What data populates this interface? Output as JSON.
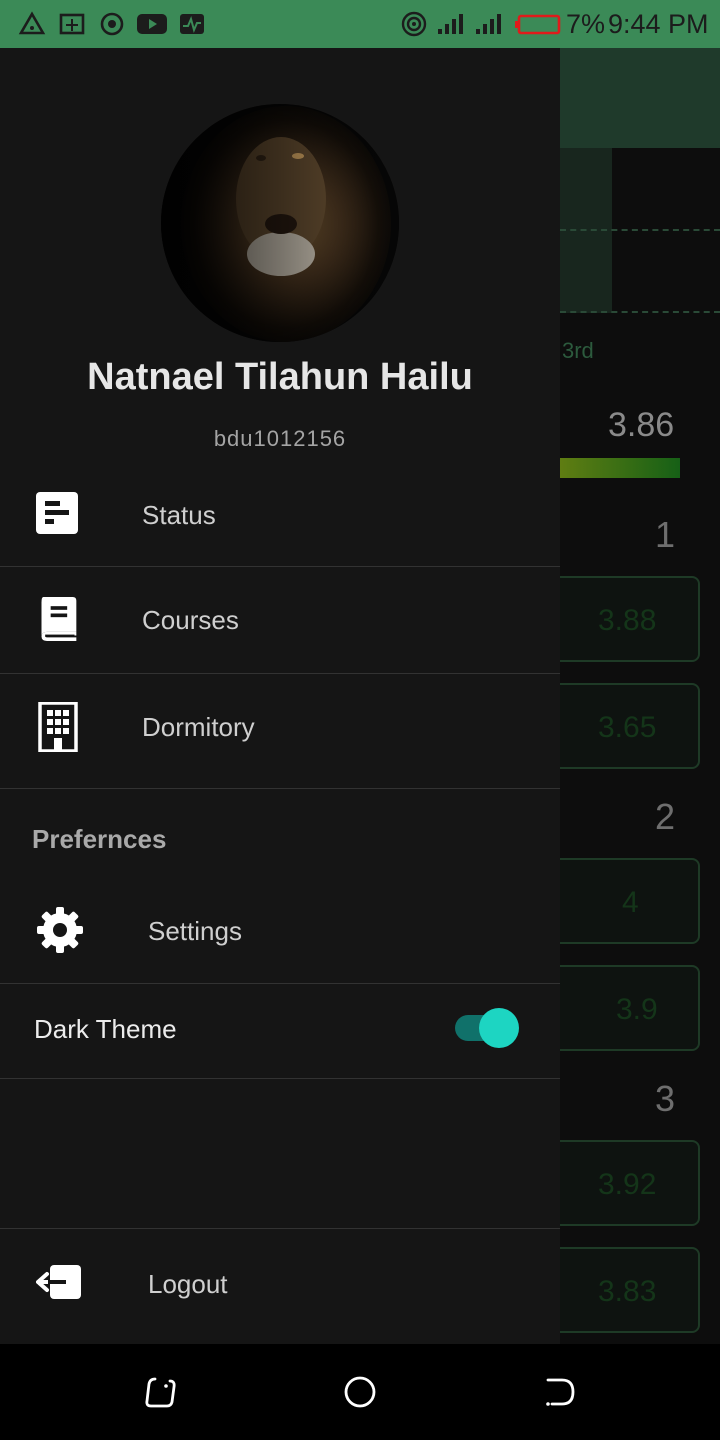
{
  "status_bar": {
    "battery_percent": "7%",
    "time": "9:44 PM",
    "background_color": "#3b8a57",
    "left_icons": [
      "alert-triangle-icon",
      "cast-icon",
      "target-icon",
      "youtube-icon",
      "activity-icon"
    ],
    "right_icons": [
      "hotspot-icon",
      "signal-icon",
      "signal-icon",
      "battery-low-icon"
    ]
  },
  "background_screen": {
    "year_label": "3rd",
    "gpa_value": "3.86",
    "semesters": [
      {
        "number": "1",
        "values": [
          "3.88",
          "3.65"
        ]
      },
      {
        "number": "2",
        "values": [
          "4",
          "3.9"
        ]
      },
      {
        "number": "3",
        "values": [
          "3.92",
          "3.83"
        ]
      }
    ]
  },
  "drawer": {
    "user_name": "Natnael Tilahun Hailu",
    "user_id": "bdu1012156",
    "menu": [
      {
        "label": "Status",
        "icon": "status-icon"
      },
      {
        "label": "Courses",
        "icon": "book-icon"
      },
      {
        "label": "Dormitory",
        "icon": "building-icon"
      }
    ],
    "preferences_title": "Prefernces",
    "settings_label": "Settings",
    "dark_theme_label": "Dark Theme",
    "dark_theme_enabled": true,
    "logout_label": "Logout",
    "accent_color": "#1dd5c2"
  },
  "nav_bar": {
    "buttons": [
      "recent-apps-icon",
      "home-icon",
      "back-icon"
    ]
  }
}
